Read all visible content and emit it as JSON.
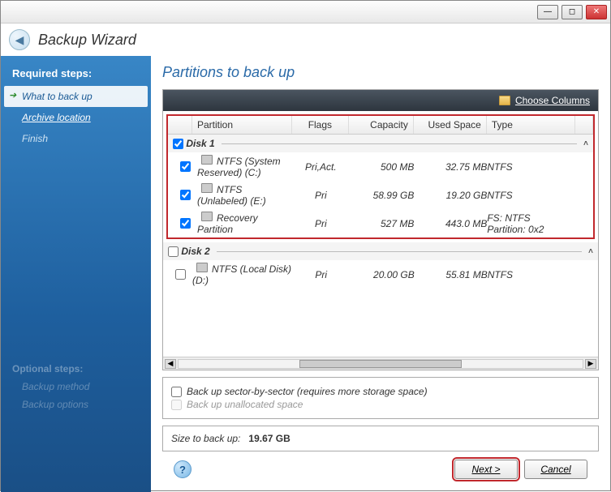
{
  "window": {
    "title": "Backup Wizard"
  },
  "sidebar": {
    "heading": "Required steps:",
    "steps": [
      {
        "label": "What to back up",
        "state": "active"
      },
      {
        "label": "Archive location",
        "state": "link"
      },
      {
        "label": "Finish",
        "state": "dim"
      }
    ],
    "optional_heading": "Optional steps:",
    "optional_steps": [
      {
        "label": "Backup method"
      },
      {
        "label": "Backup options"
      }
    ]
  },
  "content": {
    "title": "Partitions to back up",
    "choose_columns": "Choose Columns",
    "columns": {
      "partition": "Partition",
      "flags": "Flags",
      "capacity": "Capacity",
      "used": "Used Space",
      "type": "Type"
    },
    "disks": [
      {
        "name": "Disk 1",
        "checked": true,
        "highlighted": true,
        "partitions": [
          {
            "checked": true,
            "name": "NTFS (System Reserved) (C:)",
            "flags": "Pri,Act.",
            "capacity": "500 MB",
            "used": "32.75 MB",
            "type": "NTFS"
          },
          {
            "checked": true,
            "name": "NTFS (Unlabeled) (E:)",
            "flags": "Pri",
            "capacity": "58.99 GB",
            "used": "19.20 GB",
            "type": "NTFS"
          },
          {
            "checked": true,
            "name": "Recovery Partition",
            "flags": "Pri",
            "capacity": "527 MB",
            "used": "443.0 MB",
            "type": "FS: NTFS Partition: 0x2"
          }
        ]
      },
      {
        "name": "Disk 2",
        "checked": false,
        "highlighted": false,
        "partitions": [
          {
            "checked": false,
            "name": "NTFS (Local Disk) (D:)",
            "flags": "Pri",
            "capacity": "20.00 GB",
            "used": "55.81 MB",
            "type": "NTFS"
          }
        ]
      }
    ],
    "options": {
      "sector_by_sector": {
        "label": "Back up sector-by-sector (requires more storage space)",
        "checked": false,
        "enabled": true
      },
      "unallocated": {
        "label": "Back up unallocated space",
        "checked": false,
        "enabled": false
      }
    },
    "size_label": "Size to back up:",
    "size_value": "19.67 GB"
  },
  "footer": {
    "next": "Next >",
    "cancel": "Cancel"
  }
}
